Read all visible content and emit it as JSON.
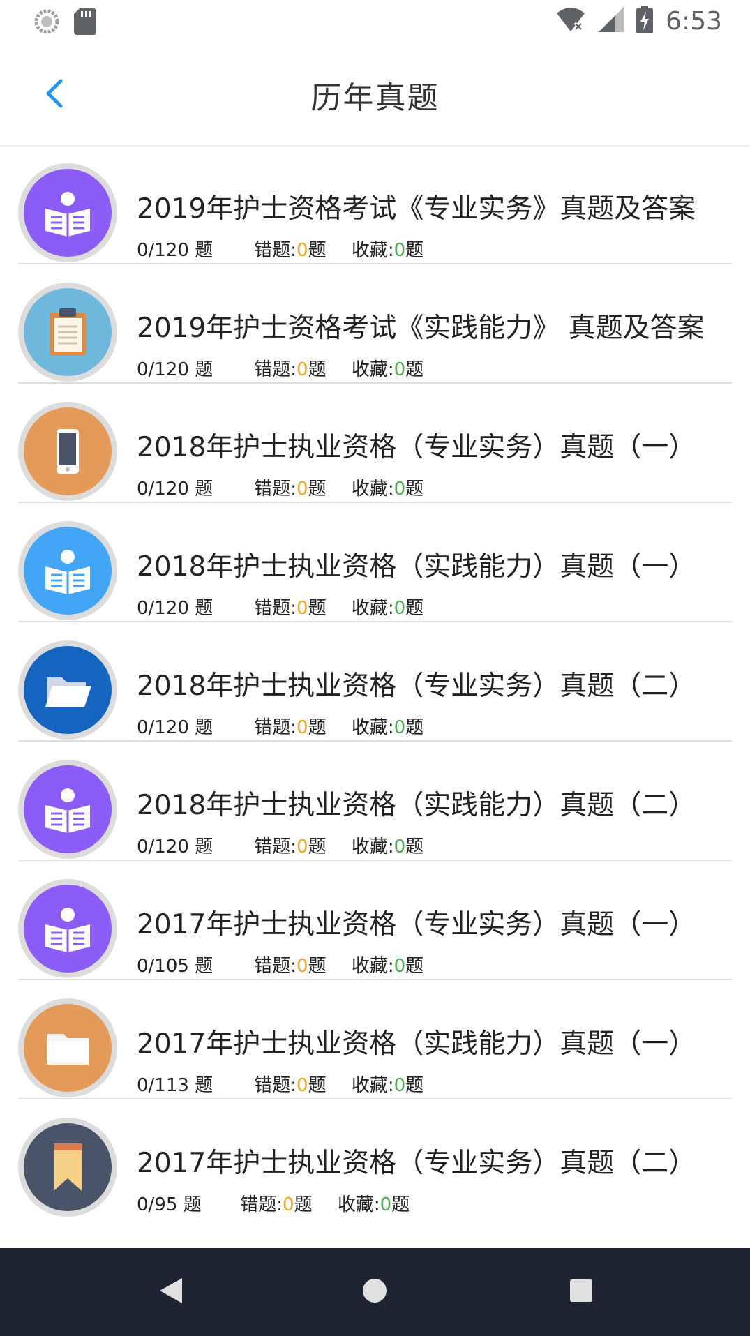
{
  "status_bar": {
    "time": "6:53",
    "icons": [
      "sync-icon",
      "sd-card-icon",
      "wifi-off-icon",
      "signal-icon",
      "battery-charging-icon"
    ]
  },
  "header": {
    "title": "历年真题",
    "back_icon": "chevron-left-icon",
    "accent_color": "#2196f3"
  },
  "colors": {
    "wrong_count": "#f3a51c",
    "favorite_count": "#4caf50",
    "nav_bar": "#1f2433"
  },
  "exams": [
    {
      "title": "2019年护士资格考试《专业实务》真题及答案",
      "progress": "0/120 题",
      "wrong_label": "错题:",
      "wrong_count": "0",
      "wrong_unit": "题",
      "fav_label": "收藏:",
      "fav_count": "0",
      "fav_unit": "题",
      "icon": "reading-person-icon",
      "icon_color": "#8b5cf6"
    },
    {
      "title": "2019年护士资格考试《实践能力》 真题及答案",
      "progress": "0/120 题",
      "wrong_label": "错题:",
      "wrong_count": "0",
      "wrong_unit": "题",
      "fav_label": "收藏:",
      "fav_count": "0",
      "fav_unit": "题",
      "icon": "clipboard-icon",
      "icon_color": "#6fb7dc"
    },
    {
      "title": "2018年护士执业资格（专业实务）真题（一）",
      "progress": "0/120 题",
      "wrong_label": "错题:",
      "wrong_count": "0",
      "wrong_unit": "题",
      "fav_label": "收藏:",
      "fav_count": "0",
      "fav_unit": "题",
      "icon": "phone-icon",
      "icon_color": "#e49b5a"
    },
    {
      "title": "2018年护士执业资格（实践能力）真题（一）",
      "progress": "0/120 题",
      "wrong_label": "错题:",
      "wrong_count": "0",
      "wrong_unit": "题",
      "fav_label": "收藏:",
      "fav_count": "0",
      "fav_unit": "题",
      "icon": "reading-person-icon",
      "icon_color": "#42a5f5"
    },
    {
      "title": "2018年护士执业资格（专业实务）真题（二）",
      "progress": "0/120 题",
      "wrong_label": "错题:",
      "wrong_count": "0",
      "wrong_unit": "题",
      "fav_label": "收藏:",
      "fav_count": "0",
      "fav_unit": "题",
      "icon": "folder-open-icon",
      "icon_color": "#1565c0"
    },
    {
      "title": "2018年护士执业资格（实践能力）真题（二）",
      "progress": "0/120 题",
      "wrong_label": "错题:",
      "wrong_count": "0",
      "wrong_unit": "题",
      "fav_label": "收藏:",
      "fav_count": "0",
      "fav_unit": "题",
      "icon": "reading-person-icon",
      "icon_color": "#8b5cf6"
    },
    {
      "title": "2017年护士执业资格（专业实务）真题（一）",
      "progress": "0/105 题",
      "wrong_label": "错题:",
      "wrong_count": "0",
      "wrong_unit": "题",
      "fav_label": "收藏:",
      "fav_count": "0",
      "fav_unit": "题",
      "icon": "reading-person-icon",
      "icon_color": "#8b5cf6"
    },
    {
      "title": "2017年护士执业资格（实践能力）真题（一）",
      "progress": "0/113 题",
      "wrong_label": "错题:",
      "wrong_count": "0",
      "wrong_unit": "题",
      "fav_label": "收藏:",
      "fav_count": "0",
      "fav_unit": "题",
      "icon": "folder-icon",
      "icon_color": "#e49b5a"
    },
    {
      "title": "2017年护士执业资格（专业实务）真题（二）",
      "progress": "0/95 题",
      "wrong_label": "错题:",
      "wrong_count": "0",
      "wrong_unit": "题",
      "fav_label": "收藏:",
      "fav_count": "0",
      "fav_unit": "题",
      "icon": "bookmark-icon",
      "icon_color": "#4a5468"
    }
  ],
  "nav_bar": {
    "back": "nav-back-icon",
    "home": "nav-home-icon",
    "recents": "nav-recents-icon"
  }
}
